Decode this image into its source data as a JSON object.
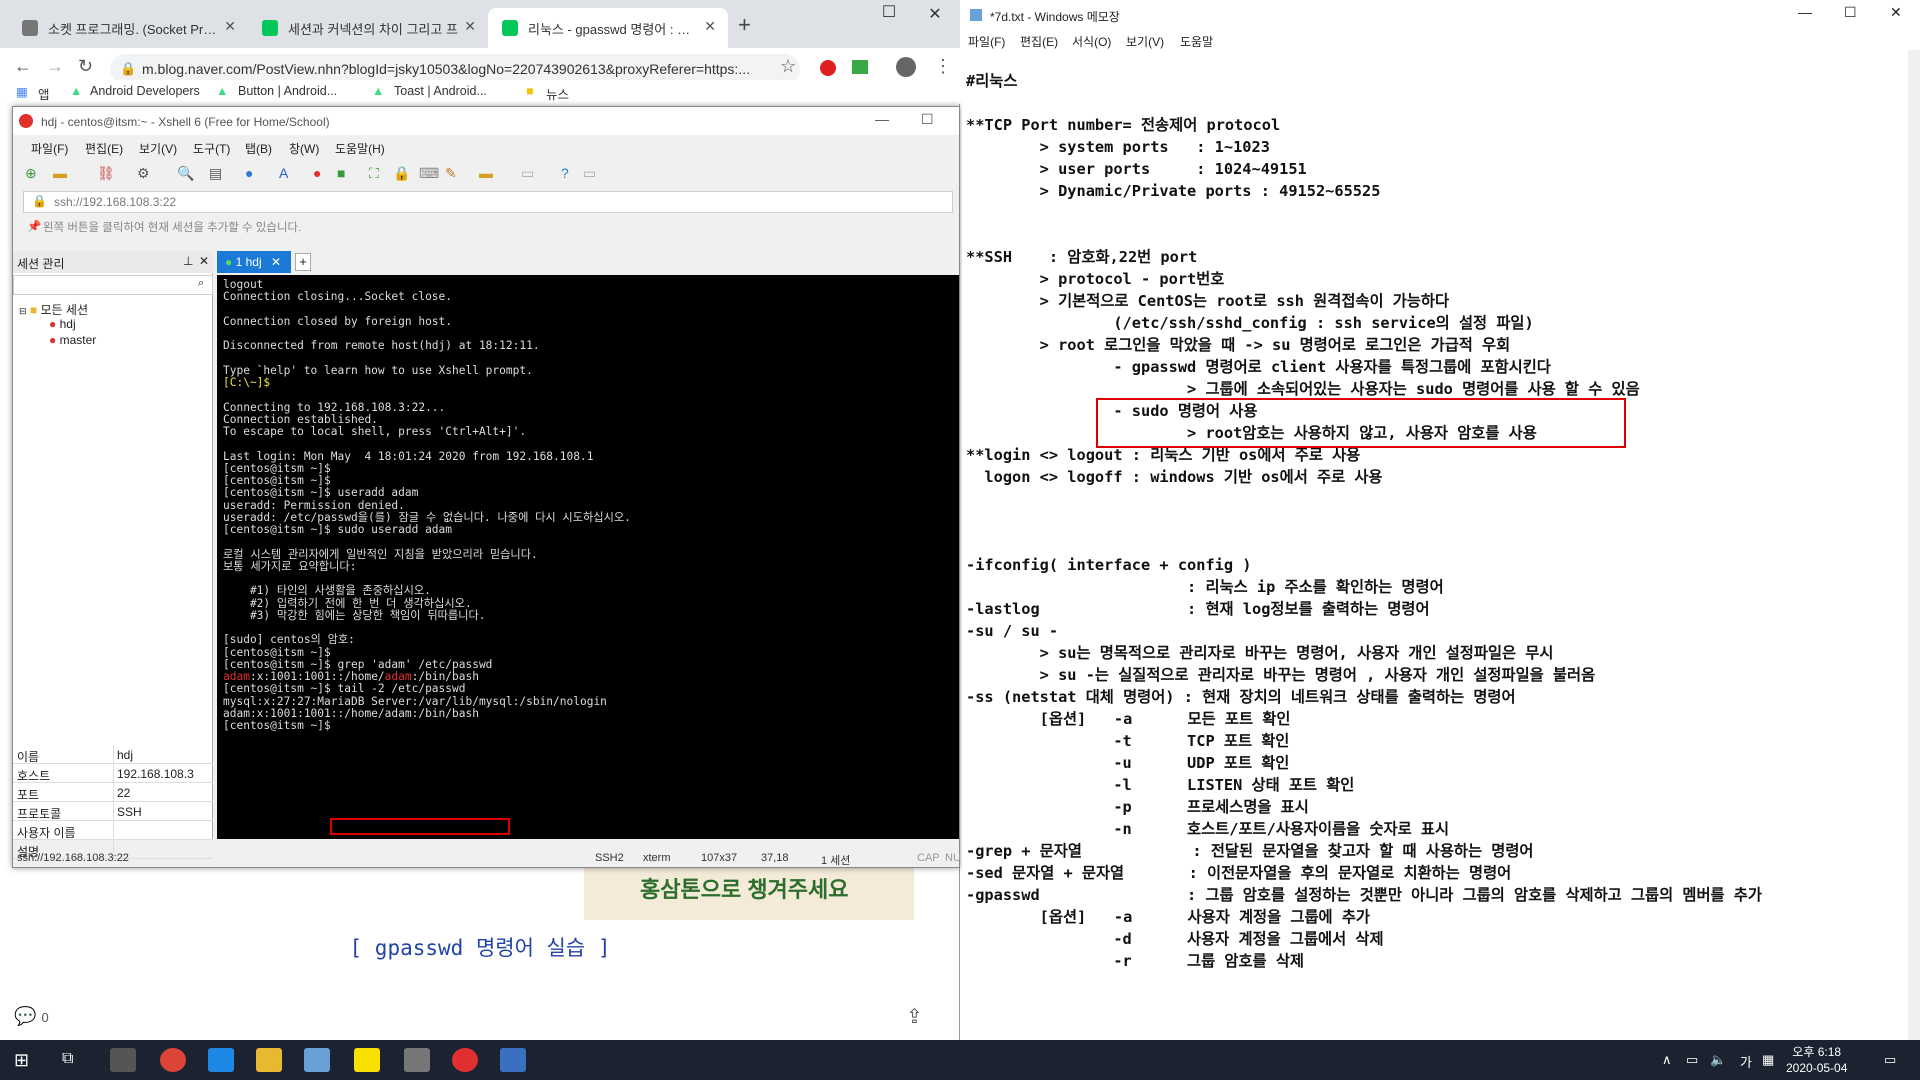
{
  "chrome": {
    "tabs": [
      {
        "label": "소켓 프로그래밍. (Socket Progra",
        "fav_color": "#555555"
      },
      {
        "label": "세션과 커넥션의 차이 그리고 프",
        "fav_color": "#03c75a"
      },
      {
        "label": "리눅스 - gpasswd 명령어 : 네이",
        "fav_color": "#03c75a"
      }
    ],
    "url": "m.blog.naver.com/PostView.nhn?blogId=jsky10503&logNo=220743902613&proxyReferer=https:...",
    "bookmarks": [
      "앱",
      "Android Developers",
      "Button | Android...",
      "Toast | Android...",
      "뉴스"
    ],
    "page_caption": "[ gpasswd 명령어 실습 ]",
    "ad_text": "홍삼톤으로 챙겨주세요",
    "comment_count": "0"
  },
  "xshell": {
    "title": "hdj - centos@itsm:~ - Xshell 6 (Free for Home/School)",
    "menu": [
      "파일(F)",
      "편집(E)",
      "보기(V)",
      "도구(T)",
      "탭(B)",
      "창(W)",
      "도움말(H)"
    ],
    "address": "ssh://192.168.108.3:22",
    "hint": "왼쪽 버튼을 클릭하여 현재 세션을 추가할 수 있습니다.",
    "session_panel_title": "세션 관리",
    "tree": {
      "root": "모든 세션",
      "items": [
        "hdj",
        "master"
      ]
    },
    "props": [
      {
        "k": "이름",
        "v": "hdj"
      },
      {
        "k": "호스트",
        "v": "192.168.108.3"
      },
      {
        "k": "포트",
        "v": "22"
      },
      {
        "k": "프로토콜",
        "v": "SSH"
      },
      {
        "k": "사용자 이름",
        "v": ""
      },
      {
        "k": "설명",
        "v": ""
      }
    ],
    "active_tab": "1 hdj",
    "terminal_lines": [
      "logout",
      "Connection closing...Socket close.",
      "",
      "Connection closed by foreign host.",
      "",
      "Disconnected from remote host(hdj) at 18:12:11.",
      "",
      "Type `help' to learn how to use Xshell prompt.",
      "[C:\\~]$",
      "",
      "Connecting to 192.168.108.3:22...",
      "Connection established.",
      "To escape to local shell, press 'Ctrl+Alt+]'.",
      "",
      "Last login: Mon May  4 18:01:24 2020 from 192.168.108.1",
      "[centos@itsm ~]$",
      "[centos@itsm ~]$",
      "[centos@itsm ~]$ useradd adam",
      "useradd: Permission denied.",
      "useradd: /etc/passwd을(를) 잠글 수 없습니다. 나중에 다시 시도하십시오.",
      "[centos@itsm ~]$ sudo useradd adam",
      "",
      "로컬 시스템 관리자에게 일반적인 지침을 받았으리라 믿습니다.",
      "보통 세가지로 요약합니다:",
      "",
      "    #1) 타인의 사생활을 존중하십시오.",
      "    #2) 입력하기 전에 한 번 더 생각하십시오.",
      "    #3) 막강한 힘에는 상당한 책임이 뒤따릅니다.",
      "",
      "[sudo] centos의 암호:",
      "[centos@itsm ~]$",
      "[centos@itsm ~]$ grep 'adam' /etc/passwd",
      "adam:x:1001:1001::/home/adam:/bin/bash",
      "[centos@itsm ~]$ tail -2 /etc/passwd",
      "mysql:x:27:27:MariaDB Server:/var/lib/mysql:/sbin/nologin",
      "adam:x:1001:1001::/home/adam:/bin/bash",
      "[centos@itsm ~]$ "
    ],
    "status": {
      "left": "ssh://192.168.108.3:22",
      "protocol": "SSH2",
      "term": "xterm",
      "size": "107x37",
      "pos": "37,18",
      "sessions": "1 세션",
      "cap": "CAP",
      "num": "NU"
    }
  },
  "notepad": {
    "title": "*7d.txt - Windows 메모장",
    "menu": [
      "파일(F)",
      "편집(E)",
      "서식(O)",
      "보기(V)",
      "도움말"
    ],
    "lines": [
      "#리눅스",
      "",
      "**TCP Port number= 전송제어 protocol",
      "        > system ports   : 1~1023",
      "        > user ports     : 1024~49151",
      "        > Dynamic/Private ports : 49152~65525",
      "",
      "",
      "**SSH    : 암호화,22번 port",
      "        > protocol - port번호",
      "        > 기본적으로 CentOS는 root로 ssh 원격접속이 가능하다",
      "                (/etc/ssh/sshd_config : ssh service의 설정 파일)",
      "        > root 로그인을 막았을 때 -> su 명령어로 로그인은 가급적 우회",
      "                - gpasswd 명령어로 client 사용자를 특정그룹에 포함시킨다",
      "                        > 그룹에 소속되어있는 사용자는 sudo 명령어를 사용 할 수 있음",
      "                - sudo 명령어 사용",
      "                        > root암호는 사용하지 않고, 사용자 암호를 사용",
      "**login <> logout : 리눅스 기반 os에서 주로 사용",
      "  logon <> logoff : windows 기반 os에서 주로 사용",
      "",
      "",
      "",
      "-ifconfig( interface + config )",
      "                        : 리눅스 ip 주소를 확인하는 명령어",
      "-lastlog                : 현재 log정보를 출력하는 명령어",
      "-su / su -",
      "        > su는 명목적으로 관리자로 바꾸는 명령어, 사용자 개인 설정파일은 무시",
      "        > su -는 실질적으로 관리자로 바꾸는 명령어 , 사용자 개인 설정파일을 불러옴",
      "-ss (netstat 대체 명령어) : 현재 장치의 네트워크 상태를 출력하는 명령어",
      "        [옵션]   -a      모든 포트 확인",
      "                -t      TCP 포트 확인",
      "                -u      UDP 포트 확인",
      "                -l      LISTEN 상태 포트 확인",
      "                -p      프로세스명을 표시",
      "                -n      호스트/포트/사용자이름을 숫자로 표시",
      "-grep + 문자열            : 전달된 문자열을 찾고자 할 때 사용하는 명령어",
      "-sed 문자열 + 문자열       : 이전문자열을 후의 문자열로 치환하는 명령어",
      "-gpasswd                : 그룹 암호를 설정하는 것뿐만 아니라 그룹의 암호를 삭제하고 그룹의 멤버를 추가",
      "        [옵션]   -a      사용자 계정을 그룹에 추가",
      "                -d      사용자 계정을 그룹에서 삭제",
      "                -r      그룹 암호를 삭제"
    ]
  },
  "taskbar": {
    "time": "오후 6:18",
    "date": "2020-05-04",
    "ime": "가"
  }
}
